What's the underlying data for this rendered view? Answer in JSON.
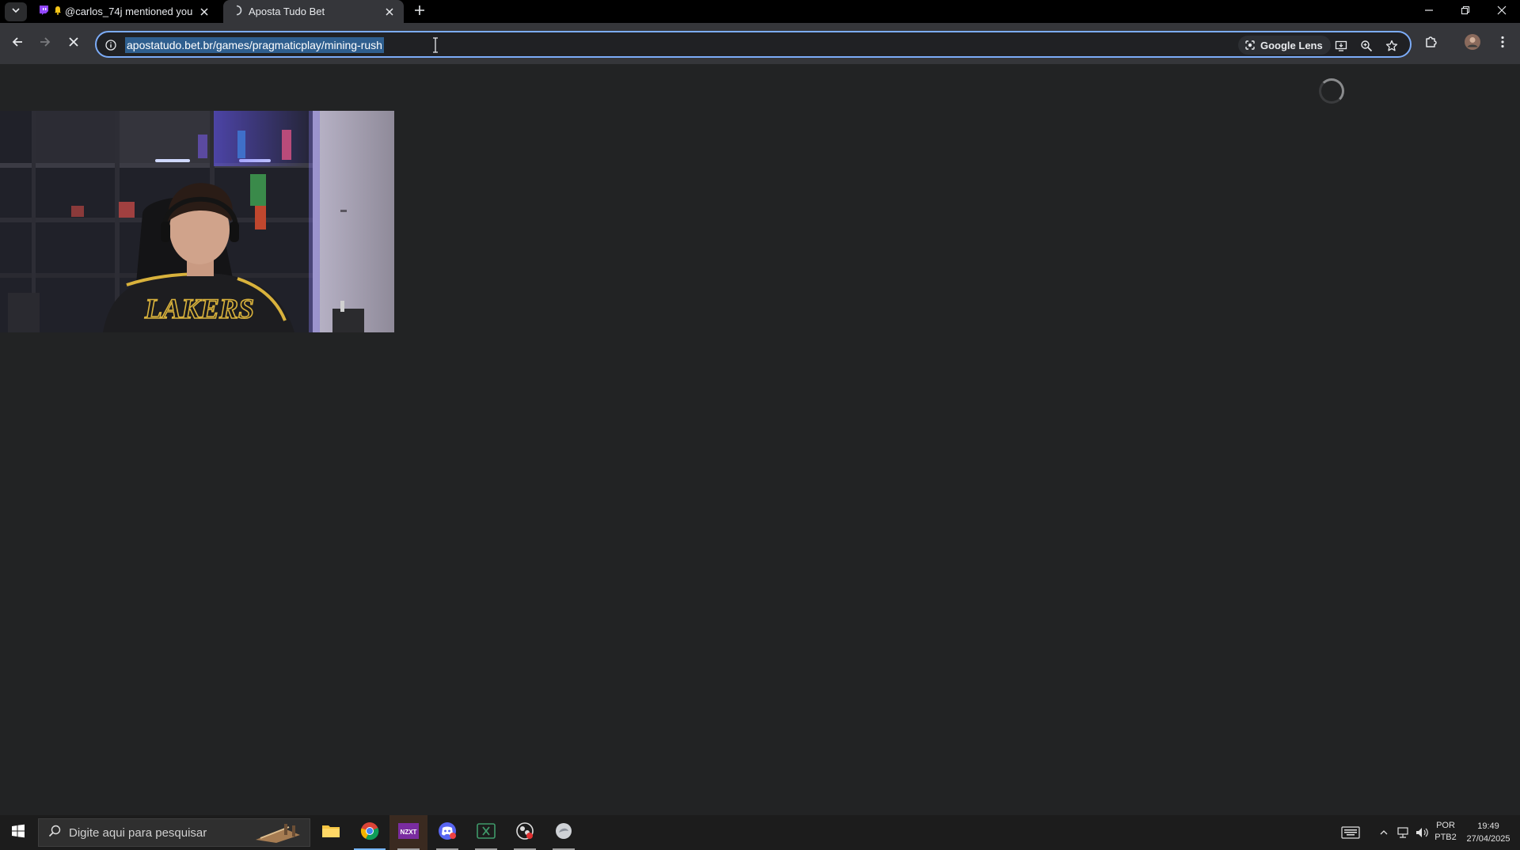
{
  "browser": {
    "tabs": [
      {
        "title": "@carlos_74j mentioned you",
        "favicon": "twitch-icon",
        "active": false
      },
      {
        "title": "Aposta Tudo Bet",
        "favicon": "loading-icon",
        "active": true
      }
    ],
    "address_bar": {
      "url": "apostatudo.bet.br/games/pragmaticplay/mining-rush",
      "lens_label": "Google Lens"
    }
  },
  "taskbar": {
    "search_placeholder": "Digite aqui para pesquisar",
    "language": {
      "line1": "POR",
      "line2": "PTB2"
    },
    "clock": {
      "time": "19:49",
      "date": "27/04/2025"
    },
    "apps": [
      "file-explorer-icon",
      "chrome-icon",
      "nzxt-icon",
      "discord-icon",
      "excel-icon",
      "obs-icon",
      "other-app-icon"
    ]
  },
  "colors": {
    "accent": "#7cacf8",
    "page_background": "#222324",
    "toolbar": "#35363a"
  }
}
